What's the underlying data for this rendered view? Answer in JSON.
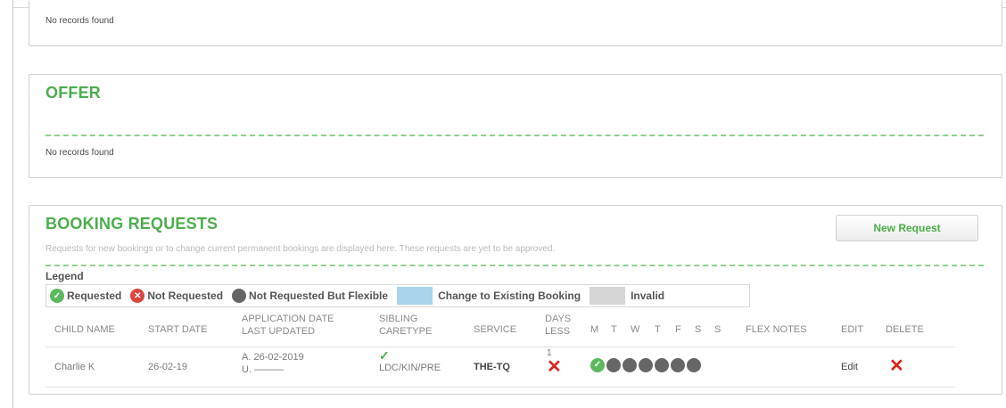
{
  "panels": {
    "top": {
      "empty_text": "No records found"
    },
    "offer": {
      "title": "OFFER",
      "empty_text": "No records found"
    },
    "booking": {
      "title": "BOOKING REQUESTS",
      "subtitle": "Requests for new bookings or to change current permanent bookings are displayed here. These requests are yet to be approved.",
      "new_request_label": "New Request",
      "legend_title": "Legend",
      "legend": {
        "requested": "Requested",
        "not_requested": "Not Requested",
        "flexible": "Not Requested But Flexible",
        "change": "Change to Existing Booking",
        "invalid": "Invalid"
      },
      "columns": {
        "child_name": "CHILD NAME",
        "start_date": "START DATE",
        "application_date": "APPLICATION DATE",
        "last_updated": "LAST UPDATED",
        "sibling": "SIBLING",
        "caretype": "CARETYPE",
        "service": "SERVICE",
        "days": "DAYS",
        "less": "LESS",
        "m": "M",
        "t": "T",
        "w": "W",
        "t2": "T",
        "f": "F",
        "s": "S",
        "s2": "S",
        "flex_notes": "FLEX NOTES",
        "edit": "EDIT",
        "delete": "DELETE"
      },
      "rows": [
        {
          "child_name": "Charlie K",
          "start_date": "26-02-19",
          "application_date": "A. 26-02-2019",
          "last_updated": "U. ———",
          "sibling_check": "✓",
          "caretype": "LDC/KIN/PRE",
          "service": "THE-TQ",
          "days_less_value": "1",
          "edit_label": "Edit",
          "days_status": [
            "requested",
            "flexible",
            "flexible",
            "flexible",
            "flexible",
            "flexible",
            "flexible"
          ]
        }
      ]
    }
  },
  "colors": {
    "green": "#4cae4c",
    "red": "#d9261c",
    "grey_dot": "#666666",
    "change_swatch": "#a8d4ec",
    "invalid_swatch": "#d6d6d6"
  },
  "icons": {
    "requested": "check-circle-icon",
    "not_requested": "x-circle-icon",
    "flexible": "grey-circle-icon",
    "delete": "red-x-icon"
  }
}
